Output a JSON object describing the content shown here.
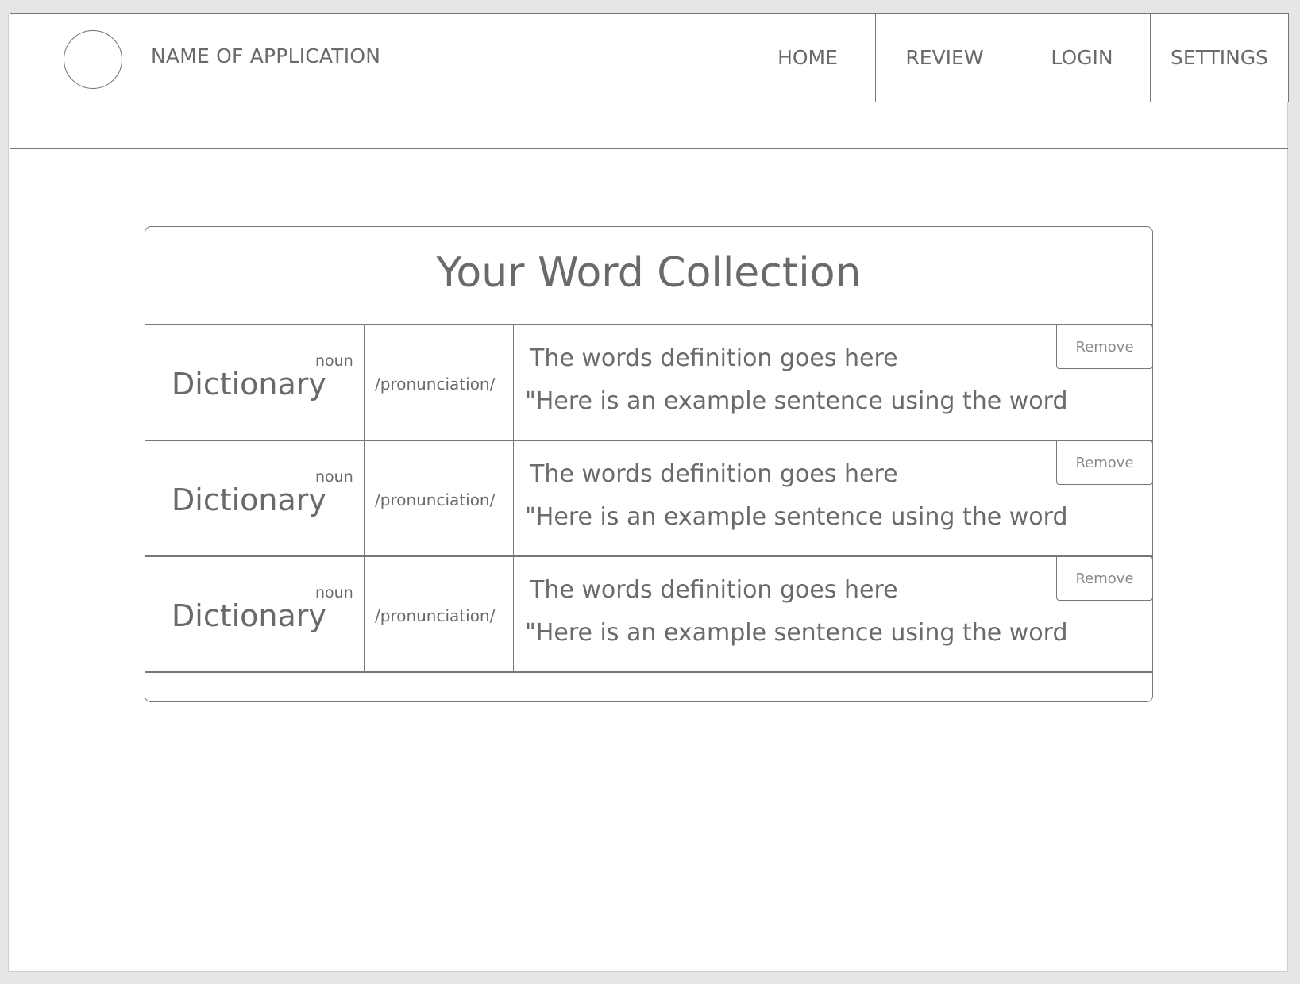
{
  "header": {
    "app_name": "NAME OF APPLICATION",
    "logo_icon": "circle-logo-icon",
    "nav": {
      "home": "HOME",
      "review": "REVIEW",
      "login": "LOGIN",
      "settings": "SETTINGS"
    }
  },
  "collection": {
    "title": "Your Word Collection",
    "entries": [
      {
        "word": "Dictionary",
        "part_of_speech": "noun",
        "pronunciation": "/pronunciation/",
        "definition": "The words definition goes here",
        "example": "\"Here is an example sentence using the word",
        "remove_label": "Remove"
      },
      {
        "word": "Dictionary",
        "part_of_speech": "noun",
        "pronunciation": "/pronunciation/",
        "definition": "The words definition goes here",
        "example": "\"Here is an example sentence using the word",
        "remove_label": "Remove"
      },
      {
        "word": "Dictionary",
        "part_of_speech": "noun",
        "pronunciation": "/pronunciation/",
        "definition": "The words definition goes here",
        "example": "\"Here is an example sentence using the word",
        "remove_label": "Remove"
      }
    ]
  },
  "colors": {
    "background": "#e6e6e6",
    "surface": "#ffffff",
    "border": "#777777",
    "text": "#6a6a6a",
    "muted_text": "#8a8a8a"
  }
}
